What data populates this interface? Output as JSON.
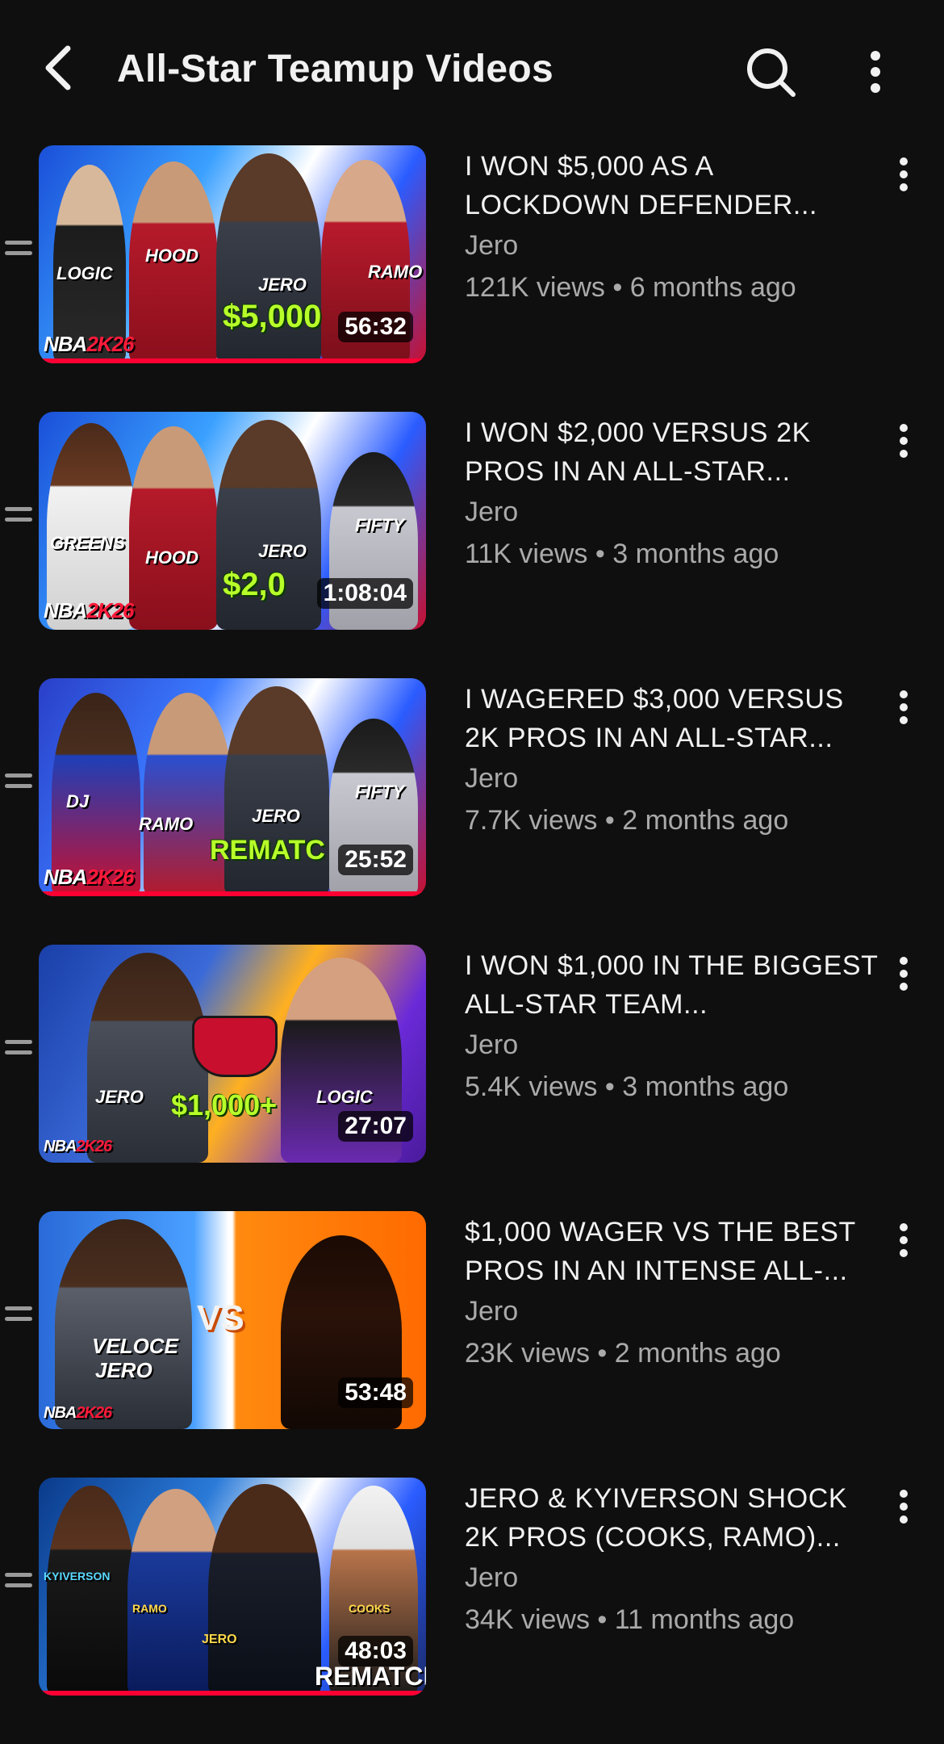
{
  "header": {
    "title": "All-Star Teamup Videos",
    "back_icon": "back-arrow-icon",
    "search_icon": "search-icon",
    "more_icon": "more-vertical-icon"
  },
  "colors": {
    "background": "#0f0f0f",
    "text_primary": "#f1f1f1",
    "text_secondary": "#aaaaaa",
    "progress": "#ff0033"
  },
  "videos": [
    {
      "title": "I WON $5,000 AS A LOCKDOWN DEFENDER...",
      "channel": "Jero",
      "views": "121K views",
      "age": "6 months ago",
      "duration": "56:32",
      "thumb_text": {
        "money": "$5,000",
        "names": [
          "LOGIC",
          "HOOD",
          "JERO",
          "RAMO"
        ],
        "brand_a": "NBA",
        "brand_b": "2K26"
      }
    },
    {
      "title": "I WON $2,000 VERSUS 2K PROS IN AN ALL-STAR...",
      "channel": "Jero",
      "views": "11K views",
      "age": "3 months ago",
      "duration": "1:08:04",
      "thumb_text": {
        "money": "$2,0",
        "names": [
          "GREENS",
          "HOOD",
          "JERO",
          "FIFTY"
        ],
        "brand_a": "NBA",
        "brand_b": "2K26"
      }
    },
    {
      "title": "I WAGERED $3,000 VERSUS 2K PROS IN AN ALL-STAR...",
      "channel": "Jero",
      "views": "7.7K views",
      "age": "2 months ago",
      "duration": "25:52",
      "thumb_text": {
        "money": "REMATC",
        "names": [
          "DJ",
          "RAMO",
          "JERO",
          "FIFTY"
        ],
        "brand_a": "NBA",
        "brand_b": "2K26"
      }
    },
    {
      "title": "I WON $1,000 IN THE BIGGEST ALL-STAR TEAM...",
      "channel": "Jero",
      "views": "5.4K views",
      "age": "3 months ago",
      "duration": "27:07",
      "thumb_text": {
        "money": "$1,000+",
        "names": [
          "JERO",
          "LOGIC"
        ],
        "brand_a": "NBA",
        "brand_b": "2K26"
      }
    },
    {
      "title": "$1,000 WAGER VS THE BEST PROS IN AN INTENSE ALL-...",
      "channel": "Jero",
      "views": "23K views",
      "age": "2 months ago",
      "duration": "53:48",
      "thumb_text": {
        "money": "VS",
        "names": [
          "VELOCE",
          "JERO"
        ],
        "brand_a": "NBA",
        "brand_b": "2K26"
      }
    },
    {
      "title": "JERO & KYIVERSON SHOCK 2K PROS (COOKS, RAMO)...",
      "channel": "Jero",
      "views": "34K views",
      "age": "11 months ago",
      "duration": "48:03",
      "thumb_text": {
        "money": "REMATCH",
        "names": [
          "KYIVERSON",
          "RAMO",
          "JERO",
          "COOKS"
        ],
        "brand_a": "",
        "brand_b": ""
      }
    }
  ],
  "separator": "•"
}
